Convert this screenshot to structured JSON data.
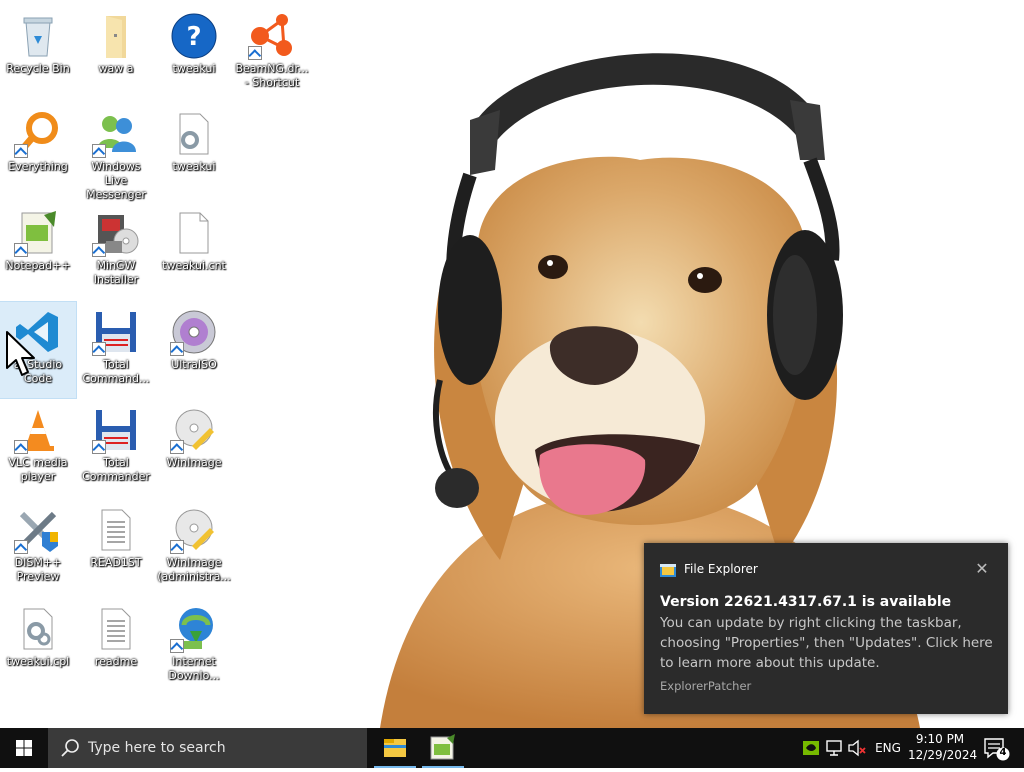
{
  "desktop": {
    "icons": [
      {
        "label": "Recycle Bin",
        "icon": "recycle-bin-icon"
      },
      {
        "label": "waw a",
        "icon": "folder-icon"
      },
      {
        "label": "tweakui",
        "icon": "help-icon"
      },
      {
        "label": "BeamNG.dr... - Shortcut",
        "icon": "beamng-icon"
      },
      {
        "label": "Everything",
        "icon": "everything-search-icon"
      },
      {
        "label": "Windows Live Messenger",
        "icon": "messenger-icon"
      },
      {
        "label": "tweakui",
        "icon": "settings-file-icon"
      },
      {
        "label": "Notepad++",
        "icon": "notepadpp-icon"
      },
      {
        "label": "MinGW Installer",
        "icon": "mingw-icon"
      },
      {
        "label": "tweakui.cnt",
        "icon": "blank-file-icon"
      },
      {
        "label": "al Studio Code",
        "icon": "vscode-icon"
      },
      {
        "label": "Total Command...",
        "icon": "total-commander-64-icon"
      },
      {
        "label": "UltraISO",
        "icon": "ultraiso-icon"
      },
      {
        "label": "VLC media player",
        "icon": "vlc-icon"
      },
      {
        "label": "Total Commander",
        "icon": "total-commander-icon"
      },
      {
        "label": "WinImage",
        "icon": "winimage-icon"
      },
      {
        "label": "DISM++ Preview",
        "icon": "dism-tools-icon"
      },
      {
        "label": "READ1ST",
        "icon": "text-file-icon"
      },
      {
        "label": "WinImage (administra...",
        "icon": "winimage-admin-icon"
      },
      {
        "label": "tweakui.cpl",
        "icon": "control-panel-file-icon"
      },
      {
        "label": "readme",
        "icon": "text-file-icon"
      },
      {
        "label": "Internet Downlo...",
        "icon": "idm-icon"
      }
    ]
  },
  "toast": {
    "app_name": "File Explorer",
    "title": "Version 22621.4317.67.1 is available",
    "body": "You can update by right clicking the taskbar, choosing \"Properties\", then \"Updates\". Click here to learn more about this update.",
    "source": "ExplorerPatcher",
    "close_glyph": "✕"
  },
  "taskbar": {
    "search_placeholder": "Type here to search",
    "apps": [
      "file-explorer-icon",
      "notepadpp-taskbar-icon"
    ],
    "tray": {
      "language": "ENG",
      "time": "9:10 PM",
      "date": "12/29/2024",
      "notification_count": "4"
    }
  },
  "colors": {
    "taskbar": "#101010",
    "search_box": "#3a3a3a",
    "toast_bg": "#2b2b2b",
    "accent": "#0078d7"
  }
}
